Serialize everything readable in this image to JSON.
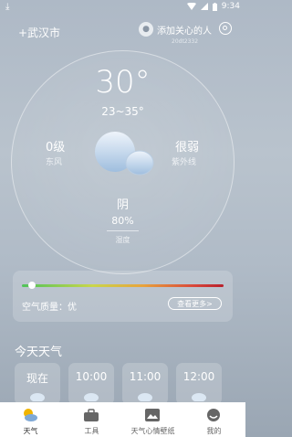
{
  "statusbar": {
    "time": "9:34",
    "download_icon": "download-icon",
    "wifi_icon": "wifi-icon",
    "signal_icon": "signal-icon",
    "battery_icon": "battery-icon"
  },
  "header": {
    "city": "+武汉市",
    "care_label": "添加关心的人",
    "care_id": "20dt2332"
  },
  "weather": {
    "temperature": "30°",
    "range": "23~35°",
    "wind_value": "0级",
    "wind_label": "东风",
    "uv_value": "很弱",
    "uv_label": "紫外线",
    "condition": "阴",
    "humidity_value": "80%",
    "humidity_label": "湿度"
  },
  "air_quality": {
    "label": "空气质量：优",
    "more_button": "查看更多>",
    "level_fraction": 0.05
  },
  "today": {
    "title": "今天天气",
    "hours": [
      {
        "label": "现在"
      },
      {
        "label": "10:00"
      },
      {
        "label": "11:00"
      },
      {
        "label": "12:00"
      }
    ]
  },
  "nav": {
    "items": [
      {
        "label": "天气",
        "icon": "weather-icon"
      },
      {
        "label": "工具",
        "icon": "toolbox-icon"
      },
      {
        "label": "天气心情壁纸",
        "icon": "wallpaper-icon"
      },
      {
        "label": "我的",
        "icon": "profile-icon"
      }
    ]
  },
  "colors": {
    "nav_active": "#f0b400",
    "aqi_good": "#4fc35a",
    "aqi_bad": "#b8202c"
  }
}
